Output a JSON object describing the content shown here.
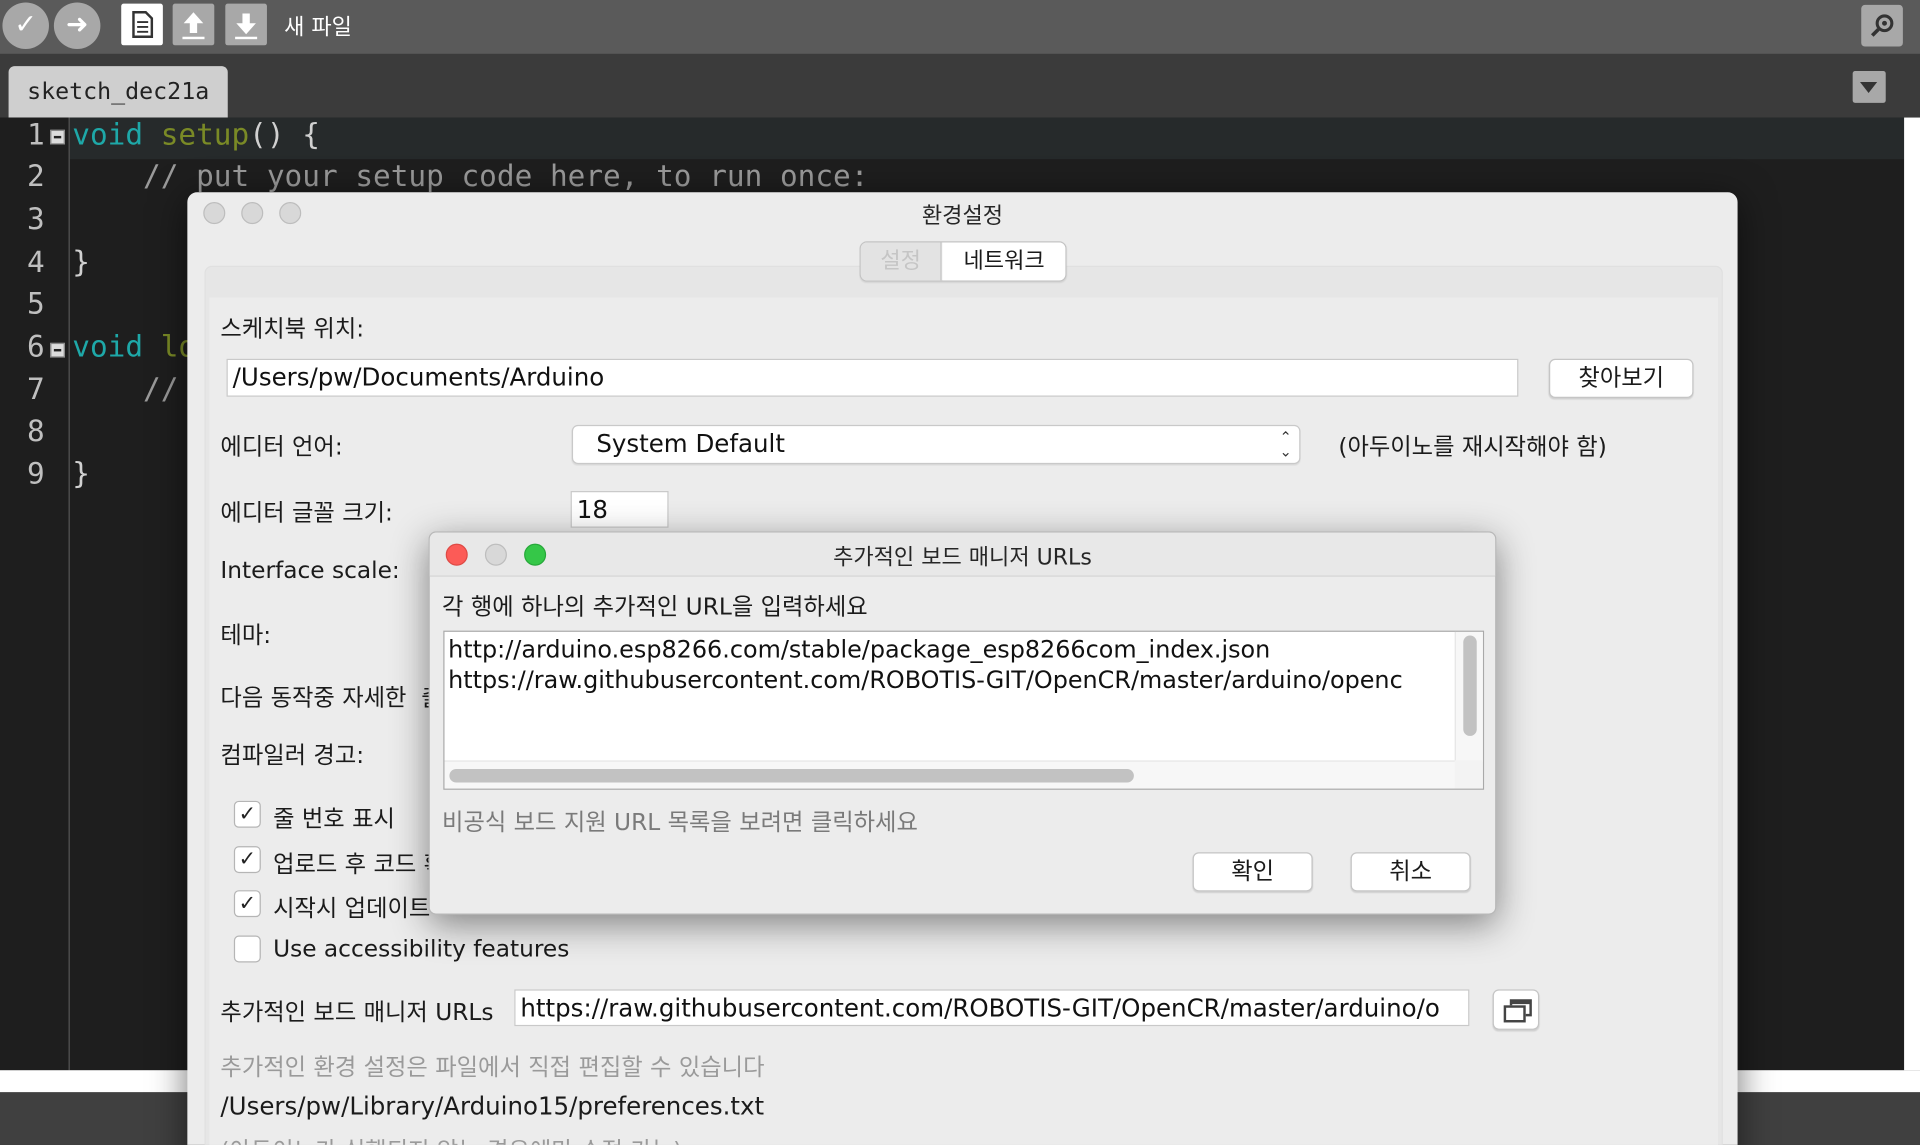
{
  "toolbar": {
    "verify_icon": "checkmark-icon",
    "upload_icon": "arrow-right-icon",
    "new_icon": "document-icon",
    "open_icon": "arrow-up-icon",
    "save_icon": "arrow-down-icon",
    "label": "새 파일",
    "serial_monitor_icon": "magnifier-icon"
  },
  "tabs": {
    "active": "sketch_dec21a"
  },
  "editor": {
    "line_numbers": [
      "1",
      "2",
      "3",
      "4",
      "5",
      "6",
      "7",
      "8",
      "9"
    ],
    "line1_kw": "void",
    "line1_fn": "setup",
    "line1_rest": "() {",
    "line2": "    // put your setup code here, to run once:",
    "line4": "}",
    "line6_kw": "void",
    "line6_fn": "lo",
    "line7": "    //",
    "line9": "}"
  },
  "prefs": {
    "title": "환경설정",
    "tab_settings": "설정",
    "tab_network": "네트워크",
    "sketchbook_label": "스케치북 위치:",
    "sketchbook_path": "/Users/pw/Documents/Arduino",
    "browse_button": "찾아보기",
    "editor_lang_label": "에디터 언어:",
    "editor_lang_value": "System Default",
    "restart_note": "(아두이노를 재시작해야 함)",
    "font_size_label": "에디터 글꼴 크기:",
    "font_size_value": "18",
    "interface_scale_label": "Interface scale:",
    "theme_label": "테마:",
    "verbose_label": "다음 동작중 자세한",
    "verbose_label_cut": "출",
    "compiler_warnings_label": "컴파일러 경고:",
    "cb_line_numbers": "줄 번호 표시",
    "cb_verify_after_upload": "업로드 후 코드 확",
    "cb_check_updates": "시작시 업데이트",
    "cb_accessibility": "Use accessibility features",
    "board_urls_label": "추가적인 보드 매니저 URLs",
    "board_urls_value": "https://raw.githubusercontent.com/ROBOTIS-GIT/OpenCR/master/arduino/o",
    "more_prefs_note": "추가적인 환경 설정은 파일에서 직접 편집할 수 있습니다",
    "prefs_file_path": "/Users/pw/Library/Arduino15/preferences.txt",
    "edit_only_when_closed": "(아두이노가 실행되지 않는 경우에만 수정 가능)"
  },
  "urls_dialog": {
    "title": "추가적인 보드 매니저 URLs",
    "instruction": "각 행에 하나의 추가적인 URL을 입력하세요",
    "urls": [
      "http://arduino.esp8266.com/stable/package_esp8266com_index.json",
      "https://raw.githubusercontent.com/ROBOTIS-GIT/OpenCR/master/arduino/openc"
    ],
    "unofficial_link": "비공식 보드 지원 URL 목록을 보려면 클릭하세요",
    "ok_button": "확인",
    "cancel_button": "취소"
  }
}
